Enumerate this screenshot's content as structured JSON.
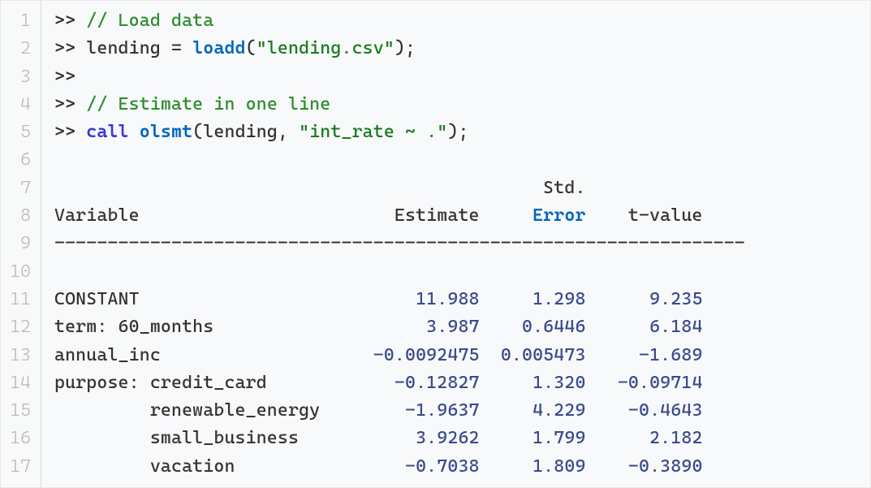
{
  "lines": {
    "count": 17
  },
  "code": {
    "prompt": ">>",
    "comment1": "// Load data",
    "var1": "lending",
    "func_loadd": "loadd",
    "str_lending": "\"lending.csv\"",
    "comment2": "// Estimate in one line",
    "kw_call": "call",
    "func_olsmt": "olsmt",
    "arg_lending": "lending",
    "str_formula": "\"int_rate ~ .\""
  },
  "output": {
    "header_top": "                                              Std.",
    "header_main_pre": "Variable                        Estimate     ",
    "header_error": "Error",
    "header_main_post": "    t-value",
    "divider": "-----------------------------------------------------------------",
    "rows": [
      {
        "variable": "CONSTANT",
        "estimate": "11.988",
        "stderr": "1.298",
        "tvalue": "9.235"
      },
      {
        "variable": "term: 60_months",
        "estimate": "3.987",
        "stderr": "0.6446",
        "tvalue": "6.184"
      },
      {
        "variable": "annual_inc",
        "estimate": "-0.0092475",
        "stderr": "0.005473",
        "tvalue": "-1.689"
      },
      {
        "variable": "purpose: credit_card",
        "estimate": "-0.12827",
        "stderr": "1.320",
        "tvalue": "-0.09714"
      },
      {
        "variable": "         renewable_energy",
        "estimate": "-1.9637",
        "stderr": "4.229",
        "tvalue": "-0.4643"
      },
      {
        "variable": "         small_business",
        "estimate": "3.9262",
        "stderr": "1.799",
        "tvalue": "2.182"
      },
      {
        "variable": "         vacation",
        "estimate": "-0.7038",
        "stderr": "1.809",
        "tvalue": "-0.3890"
      }
    ]
  }
}
